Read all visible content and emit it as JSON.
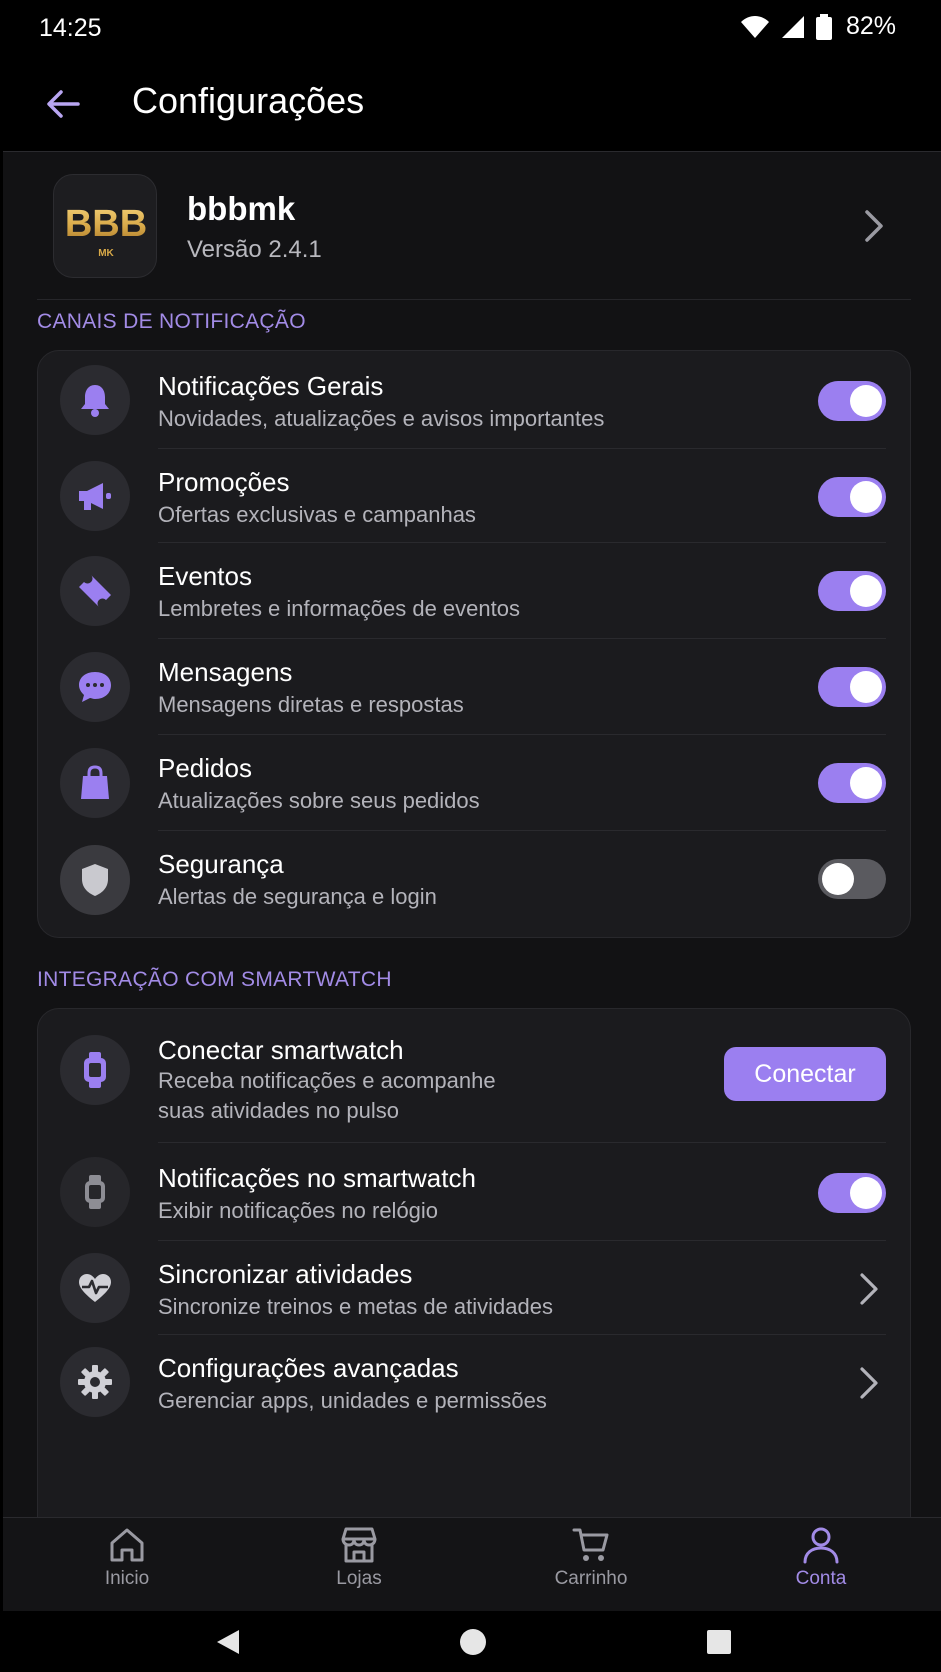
{
  "status_bar": {
    "time": "14:25",
    "battery": "82%"
  },
  "app_bar": {
    "title": "Configurações"
  },
  "app_info": {
    "logo_text": "BBB",
    "logo_subtext": "MK",
    "name": "bbbmk",
    "version": "Versão 2.4.1"
  },
  "notification_channels": {
    "title": "CANAIS DE NOTIFICAÇÃO",
    "items": [
      {
        "icon": "bell-icon",
        "title": "Notificações Gerais",
        "subtitle": "Novidades, atualizações e avisos importantes",
        "enabled": true
      },
      {
        "icon": "megaphone-icon",
        "title": "Promoções",
        "subtitle": "Ofertas exclusivas e campanhas",
        "enabled": true
      },
      {
        "icon": "ticket-icon",
        "title": "Eventos",
        "subtitle": "Lembretes e informações de eventos",
        "enabled": true
      },
      {
        "icon": "chat-icon",
        "title": "Mensagens",
        "subtitle": "Mensagens diretas e respostas",
        "enabled": true
      },
      {
        "icon": "shopping-bag-icon",
        "title": "Pedidos",
        "subtitle": "Atualizações sobre seus pedidos",
        "enabled": true
      },
      {
        "icon": "shield-icon",
        "title": "Segurança",
        "subtitle": "Alertas de segurança e login",
        "enabled": false
      }
    ]
  },
  "smartwatch": {
    "title": "INTEGRAÇÃO COM SMARTWATCH",
    "connect": {
      "title": "Conectar smartwatch",
      "subtitle_line1": "Receba notificações e acompanhe",
      "subtitle_line2": "suas atividades no pulso",
      "button_label": "Conectar"
    },
    "notifications": {
      "title": "Notificações no smartwatch",
      "subtitle": "Exibir notificações no relógio",
      "enabled": true
    },
    "sync": {
      "title": "Sincronizar atividades",
      "subtitle": "Sincronize treinos e metas de atividades"
    },
    "advanced": {
      "title": "Configurações avançadas",
      "subtitle": "Gerenciar apps, unidades e permissões"
    }
  },
  "bottom_nav": {
    "items": [
      {
        "icon": "home-icon",
        "label": "Inicio",
        "active": false
      },
      {
        "icon": "store-icon",
        "label": "Lojas",
        "active": false
      },
      {
        "icon": "cart-icon",
        "label": "Carrinho",
        "active": false
      },
      {
        "icon": "user-icon",
        "label": "Conta",
        "active": true
      }
    ]
  },
  "colors": {
    "accent": "#9b7ff0",
    "section_title": "#a28be6",
    "card_bg": "#1b1b1e",
    "page_bg": "#121214",
    "logo_gold": "#d8a948"
  }
}
